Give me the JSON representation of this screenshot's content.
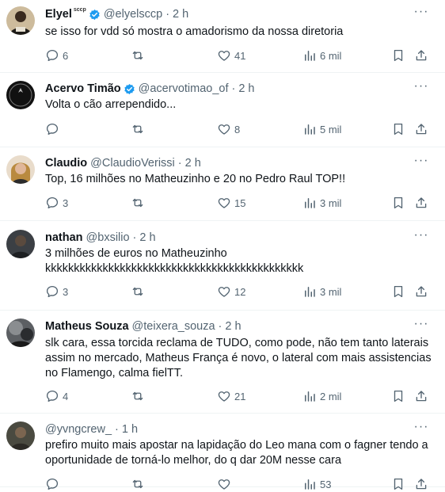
{
  "tweets": [
    {
      "name": "Elyel",
      "badge": "sccp",
      "verified": true,
      "handle": "@elyelsccp",
      "time": "2 h",
      "text": "se isso for vdd só mostra o amadorismo da nossa diretoria",
      "replies": "6",
      "retweets": "",
      "likes": "41",
      "views": "6 mil"
    },
    {
      "name": "Acervo Timão",
      "badge": "",
      "verified": true,
      "handle": "@acervotimao_of",
      "time": "2 h",
      "text": "Volta o cão arrependido...",
      "replies": "",
      "retweets": "",
      "likes": "8",
      "views": "5 mil",
      "avatar_text": "ACERVO TIMÃO"
    },
    {
      "name": "Claudio",
      "badge": "",
      "verified": false,
      "handle": "@ClaudioVerissi",
      "time": "2 h",
      "text": "Top, 16 milhões no Matheuzinho e 20 no Pedro Raul TOP!!",
      "replies": "3",
      "retweets": "",
      "likes": "15",
      "views": "3 mil"
    },
    {
      "name": "nathan",
      "badge": "",
      "verified": false,
      "handle": "@bxsilio",
      "time": "2 h",
      "text": "3 milhões de euros no Matheuzinho\nkkkkkkkkkkkkkkkkkkkkkkkkkkkkkkkkkkkkkkkkkkkkk",
      "replies": "3",
      "retweets": "",
      "likes": "12",
      "views": "3 mil"
    },
    {
      "name": "Matheus Souza",
      "badge": "",
      "verified": false,
      "handle": "@teixera_souza",
      "time": "2 h",
      "text": "slk cara, essa torcida reclama de TUDO, como pode, não tem tanto laterais\nassim no mercado, Matheus França é novo, o lateral com mais assistencias\nno Flamengo, calma fielTT.",
      "replies": "4",
      "retweets": "",
      "likes": "21",
      "views": "2 mil"
    },
    {
      "name": "",
      "badge": "",
      "verified": false,
      "handle": "@yvngcrew_",
      "time": "1 h",
      "text": "prefiro muito mais apostar na lapidação do Leo mana com o fagner tendo a\noportunidade de torná-lo melhor, do q dar 20M nesse cara",
      "replies": "",
      "retweets": "",
      "likes": "",
      "views": "53"
    }
  ],
  "separator": "·",
  "more_label": "···",
  "colors": {
    "text": "#0f1419",
    "secondary": "#536471",
    "verified": "#1d9bf0",
    "divider": "#eff3f4"
  },
  "icons": [
    "reply-icon",
    "retweet-icon",
    "like-icon",
    "views-icon",
    "bookmark-icon",
    "share-icon",
    "verified-icon",
    "more-icon"
  ]
}
